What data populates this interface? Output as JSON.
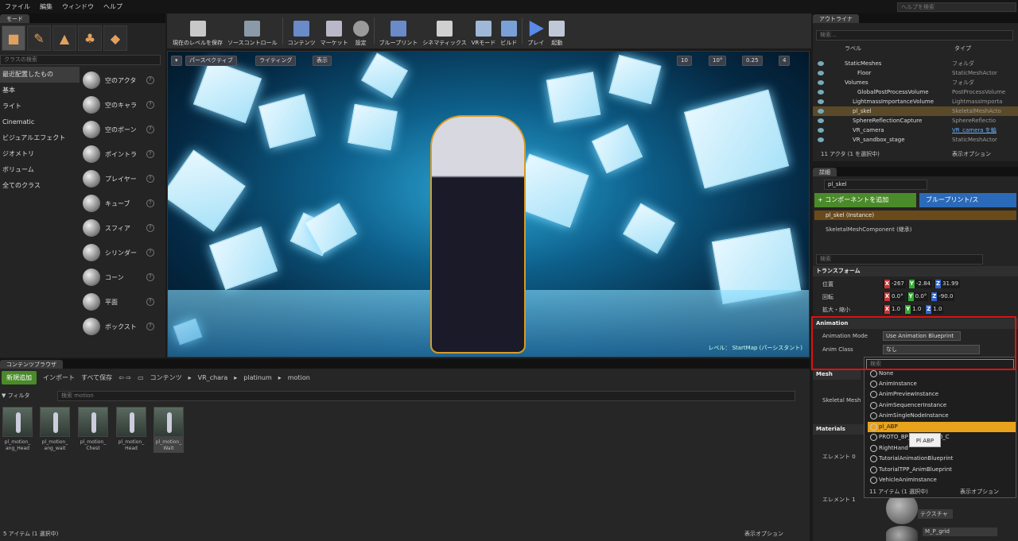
{
  "menu": [
    "ファイル",
    "編集",
    "ウィンドウ",
    "ヘルプ"
  ],
  "help_search": "ヘルプを検索",
  "modes_tab": "モード",
  "class_search": "クラスの検索",
  "categories": [
    "最近配置したもの",
    "基本",
    "ライト",
    "Cinematic",
    "ビジュアルエフェクト",
    "ジオメトリ",
    "ボリューム",
    "全てのクラス"
  ],
  "place_items": [
    "空のアクタ",
    "空のキャラ",
    "空のポーン",
    "ポイントラ",
    "プレイヤー",
    "キューブ",
    "スフィア",
    "シリンダー",
    "コーン",
    "平面",
    "ボックスト"
  ],
  "toolbar": [
    "現在のレベルを保存",
    "ソースコントロール",
    "コンテンツ",
    "マーケット",
    "設定",
    "ブループリント",
    "シネマティックス",
    "VRモード",
    "ビルド",
    "プレイ",
    "起動"
  ],
  "viewport": {
    "perspective": "パースペクティブ",
    "lighting": "ライティング",
    "show": "表示",
    "grid": "10",
    "rot": "10°",
    "scale": "0.25",
    "cam": "4",
    "level": "レベル： StartMap (パーシスタント)"
  },
  "content_browser": {
    "tab": "コンテンツブラウザ",
    "add_new": "新規追加",
    "import": "インポート",
    "save_all": "すべて保存",
    "path": [
      "コンテンツ",
      "VR_chara",
      "platinum",
      "motion"
    ],
    "filter": "フィルタ",
    "search_placeholder": "検索 motion",
    "assets": [
      "pl_motion_ ang_Head",
      "pl_motion_ ang_wait",
      "pl_motion_ Chest",
      "pl_motion_ Head",
      "pl_motion_ Wait"
    ],
    "status": "5 アイテム (1 選択中)",
    "view_options": "表示オプション"
  },
  "outliner": {
    "tab": "アウトライナ",
    "search": "検索...",
    "col_label": "ラベル",
    "col_type": "タイプ",
    "rows": [
      {
        "name": "StaticMeshes",
        "type": "フォルダ"
      },
      {
        "name": "Floor",
        "type": "StaticMeshActor"
      },
      {
        "name": "Volumes",
        "type": "フォルダ"
      },
      {
        "name": "GlobalPostProcessVolume",
        "type": "PostProcessVolume"
      },
      {
        "name": "LightmassImportanceVolume",
        "type": "LightmassImporta"
      },
      {
        "name": "pl_skel",
        "type": "SkeletalMeshActo"
      },
      {
        "name": "SphereReflectionCapture",
        "type": "SphereReflectio"
      },
      {
        "name": "VR_camera",
        "type": "VR_camera を編"
      },
      {
        "name": "VR_sandbox_stage",
        "type": "StaticMeshActor"
      }
    ],
    "status": "11 アクタ (1 を選択中)",
    "view_options": "表示オプション"
  },
  "details": {
    "tab": "詳細",
    "name": "pl_skel",
    "add_component": "+ コンポーネントを追加",
    "blueprint": "ブループリント/ス",
    "instance": "pl_skel (Instance)",
    "component": "SkeletalMeshComponent (継承)",
    "search": "検索",
    "transform": "トランスフォーム",
    "location": {
      "label": "位置",
      "x": "-267",
      "y": "-2.84",
      "z": "31.99"
    },
    "rotation": {
      "label": "回転",
      "x": "0.0°",
      "y": "0.0°",
      "z": "-90.0"
    },
    "scale": {
      "label": "拡大・縮小",
      "x": "1.0",
      "y": "1.0",
      "z": "1.0"
    },
    "animation": "Animation",
    "anim_mode_label": "Animation Mode",
    "anim_mode": "Use Animation Blueprint",
    "anim_class_label": "Anim Class",
    "anim_class": "なし",
    "mesh": "Mesh",
    "skeletal_mesh": "Skeletal Mesh",
    "materials": "Materials",
    "element0": "エレメント 0",
    "element1": "エレメント 1",
    "texture": "テクスチャ",
    "mat_name": "M_P_grid"
  },
  "popup": {
    "search": "検索",
    "items": [
      "None",
      "AnimInstance",
      "AnimPreviewInstance",
      "AnimSequencerInstance",
      "AnimSingleNodeInstance",
      "pl_ABP",
      "PROTO_BP_Blueprint_0_C",
      "RightHand",
      "TutorialAnimationBlueprint",
      "TutorialTPP_AnimBlueprint",
      "VehicleAnimInstance"
    ],
    "status": "11 アイテム (1 選択中)",
    "view_options": "表示オプション",
    "tooltip": "Pl ABP"
  }
}
